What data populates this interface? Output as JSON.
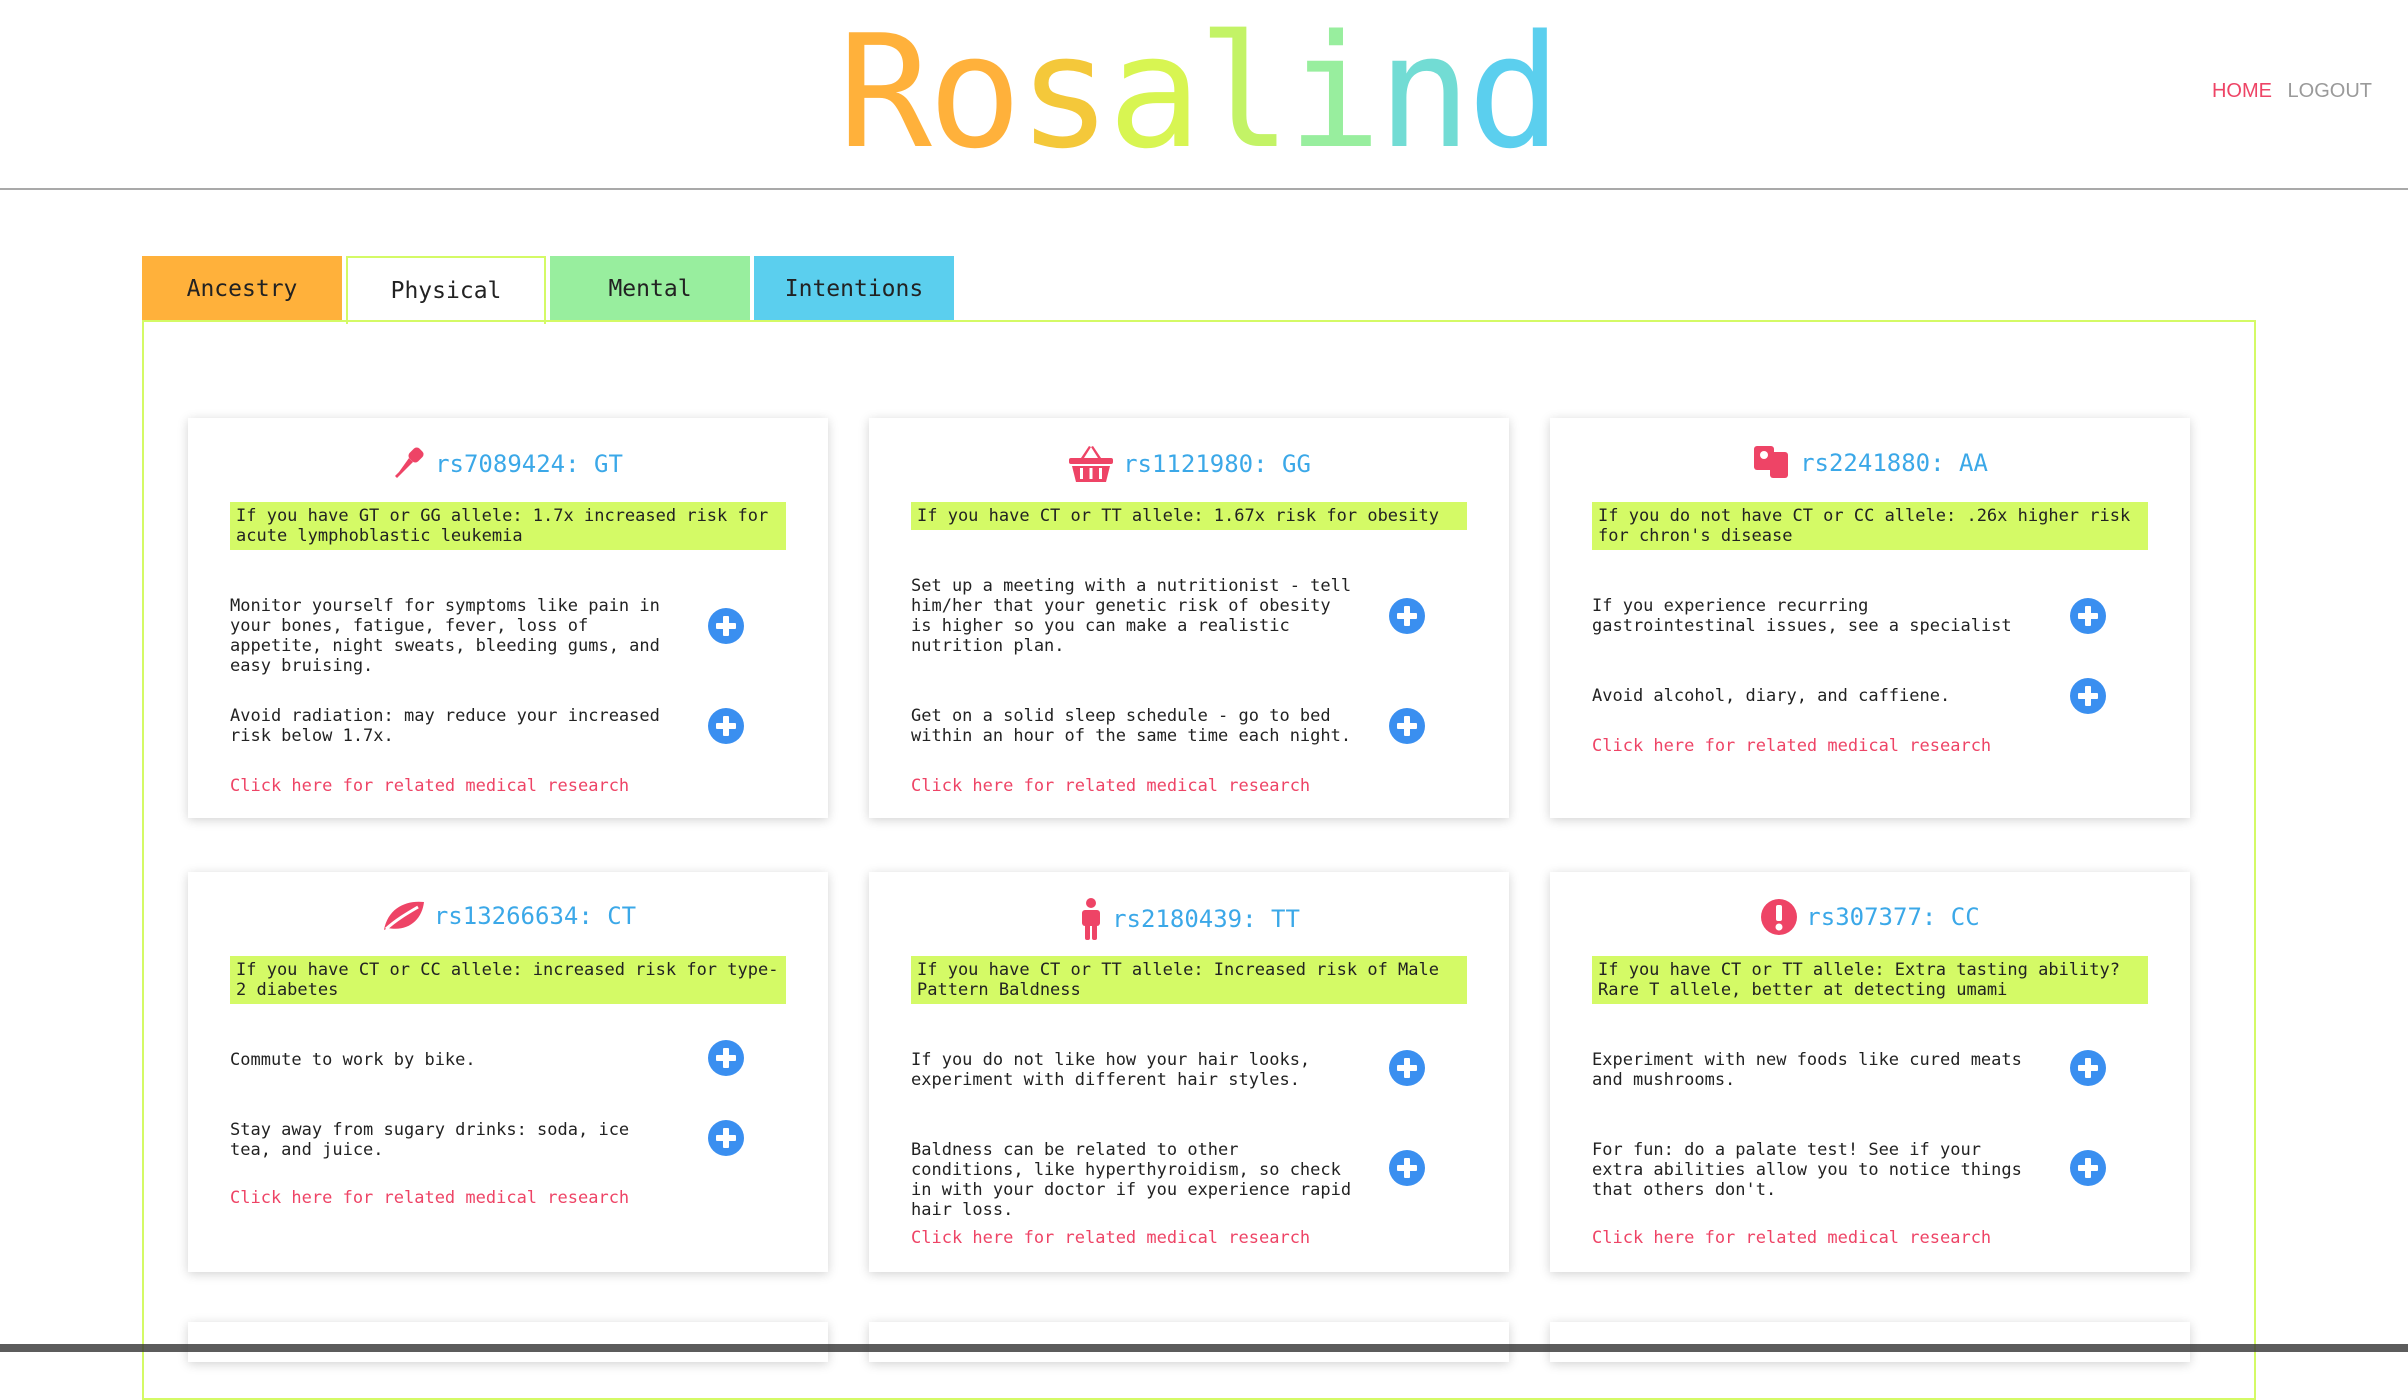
{
  "logo": {
    "letters": [
      "R",
      "o",
      "s",
      "a",
      "l",
      "i",
      "n",
      "d"
    ],
    "colors": [
      "#ffb13b",
      "#ffb13b",
      "#f4c83a",
      "#d8f552",
      "#c3f366",
      "#98ee9e",
      "#72dcd4",
      "#5bcfee"
    ]
  },
  "nav": {
    "home": "HOME",
    "logout": "LOGOUT"
  },
  "tabs": [
    {
      "label": "Ancestry",
      "color": "#ffb13b"
    },
    {
      "label": "Physical",
      "color": "#ffffff"
    },
    {
      "label": "Mental",
      "color": "#98ee9e"
    },
    {
      "label": "Intentions",
      "color": "#5bcfee"
    }
  ],
  "cards": [
    {
      "icon": "dropper-icon",
      "title": "rs7089424: GT",
      "risk": "If you have GT or GG allele: 1.7x increased risk for acute lymphoblastic leukemia",
      "recs": [
        "Monitor yourself for symptoms like pain in your bones, fatigue, fever, loss of appetite, night sweats, bleeding gums, and easy bruising.",
        "Avoid radiation: may reduce your increased risk below 1.7x."
      ],
      "research": "Click here for related medical research"
    },
    {
      "icon": "basket-icon",
      "title": "rs1121980: GG",
      "risk": "If you have CT or TT allele: 1.67x risk for obesity",
      "recs": [
        "Set up a meeting with a nutritionist - tell him/her that your genetic risk of obesity is higher so you can make a realistic nutrition plan.",
        "Get on a solid sleep schedule - go to bed within an hour of the same time each night."
      ],
      "research": "Click here for related medical research"
    },
    {
      "icon": "toilet-paper-icon",
      "title": "rs2241880: AA",
      "risk": "If you do not have CT or CC allele: .26x higher risk for chron's disease",
      "recs": [
        "If you experience recurring gastrointestinal issues, see a specialist",
        "Avoid alcohol, diary, and caffiene."
      ],
      "research": "Click here for related medical research"
    },
    {
      "icon": "leaf-icon",
      "title": "rs13266634: CT",
      "risk": "If you have CT or CC allele: increased risk for type-2 diabetes",
      "recs": [
        "Commute to work by bike.",
        "Stay away from sugary drinks: soda, ice tea, and juice."
      ],
      "research": "Click here for related medical research"
    },
    {
      "icon": "person-icon",
      "title": "rs2180439: TT",
      "risk": "If you have CT or TT allele: Increased risk of Male Pattern Baldness",
      "recs": [
        "If you do not like how your hair looks, experiment with different hair styles.",
        "Baldness can be related to other conditions, like hyperthyroidism, so check in with your doctor if you experience rapid hair loss."
      ],
      "research": "Click here for related medical research"
    },
    {
      "icon": "exclamation-icon",
      "title": "rs307377: CC",
      "risk": "If you have CT or TT allele: Extra tasting ability? Rare T allele, better at detecting umami",
      "recs": [
        "Experiment with new foods like cured meats and mushrooms.",
        "For fun: do a palate test! See if your extra abilities allow you to notice things that others don't."
      ],
      "research": "Click here for related medical research"
    }
  ],
  "colors": {
    "accent": "#ee4466",
    "blue": "#3a8ff0",
    "title_blue": "#3ba8e8",
    "highlight": "#d4fa66"
  }
}
